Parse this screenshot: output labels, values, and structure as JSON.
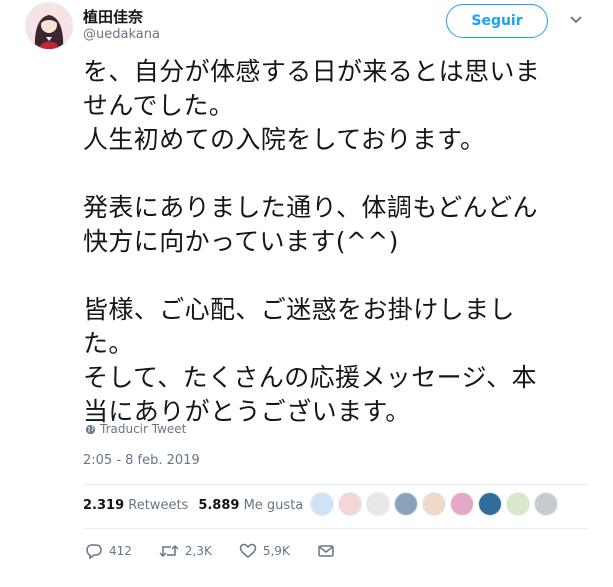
{
  "user": {
    "display_name": "植田佳奈",
    "handle": "@uedakana"
  },
  "follow_label": "Seguir",
  "tweet": {
    "paragraphs": [
      [
        "を、自分が体感する日が来るとは思いま",
        "せんでした。",
        "人生初めての入院をしております。"
      ],
      [
        "発表にありました通り、体調もどんどん",
        "快方に向かっています(^^)"
      ],
      [
        "皆様、ご心配、ご迷惑をお掛けしまし",
        "た。",
        "そして、たくさんの応援メッセージ、本",
        "当にありがとうございます。"
      ]
    ]
  },
  "translate_label": "Traducir Tweet",
  "timestamp": "2:05 - 8 feb. 2019",
  "stats": {
    "retweets_count": "2.319",
    "retweets_label": "Retweets",
    "likes_count": "5.889",
    "likes_label": "Me gusta"
  },
  "liker_avatar_colors": [
    "#cfe3f7",
    "#f4d6d6",
    "#e8e8e8",
    "#8aa3b8",
    "#f1d9c9",
    "#e3a8c6",
    "#2f6d9a",
    "#d8e8c8",
    "#c8ccd0"
  ],
  "actions": {
    "reply_count": "412",
    "retweet_count": "2,3K",
    "like_count": "5,9K"
  },
  "colors": {
    "accent": "#1da1f2",
    "text": "#14171a",
    "muted": "#657786",
    "divider": "#e6ecf0"
  }
}
